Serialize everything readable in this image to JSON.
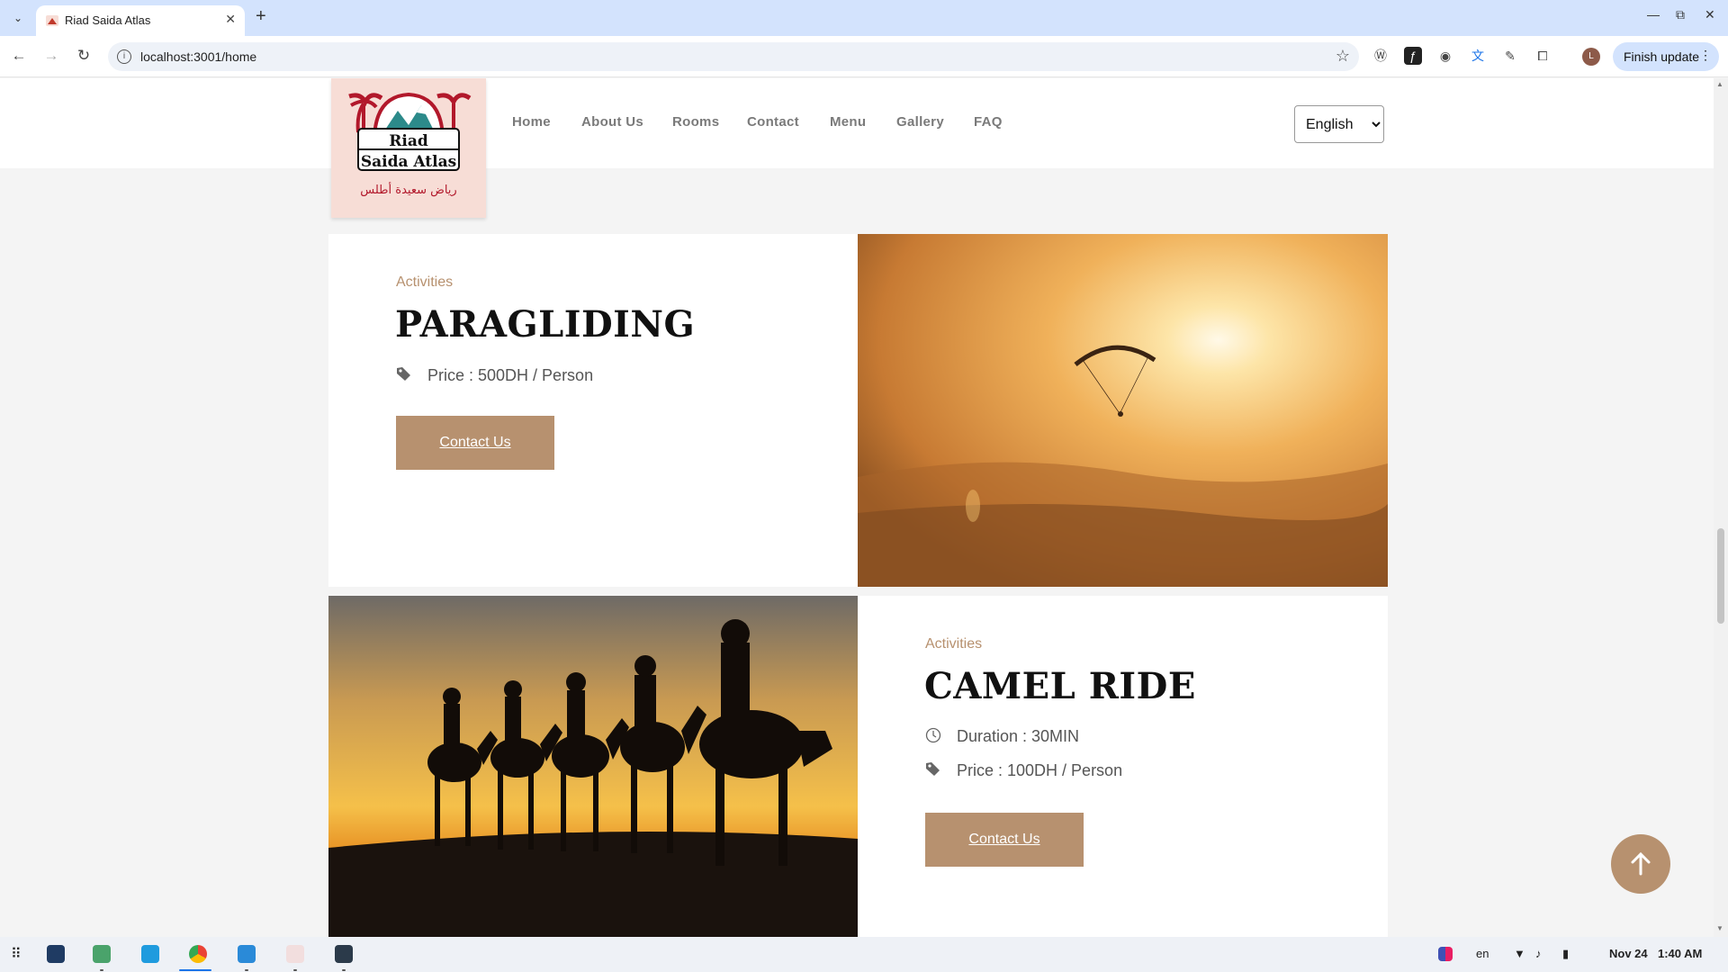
{
  "browser": {
    "tab_title": "Riad Saida Atlas",
    "url": "localhost:3001/home",
    "finish_update_label": "Finish update",
    "avatar_initial": "L"
  },
  "site": {
    "logo_alt": "Riad Saida Atlas",
    "nav": [
      "Home",
      "About Us",
      "Rooms",
      "Contact",
      "Menu",
      "Gallery",
      "FAQ"
    ],
    "language_selected": "English"
  },
  "activities": [
    {
      "category": "Activities",
      "title": "PARAGLIDING",
      "price": "Price : 500DH / Person",
      "button": "Contact Us"
    },
    {
      "category": "Activities",
      "title": "CAMEL RIDE",
      "duration": "Duration : 30MIN",
      "price": "Price : 100DH / Person",
      "button": "Contact Us"
    }
  ],
  "taskbar": {
    "lang": "en",
    "date": "Nov 24",
    "time": "1:40 AM"
  },
  "colors": {
    "accent": "#b7916f",
    "tabbar": "#d3e3fd"
  }
}
